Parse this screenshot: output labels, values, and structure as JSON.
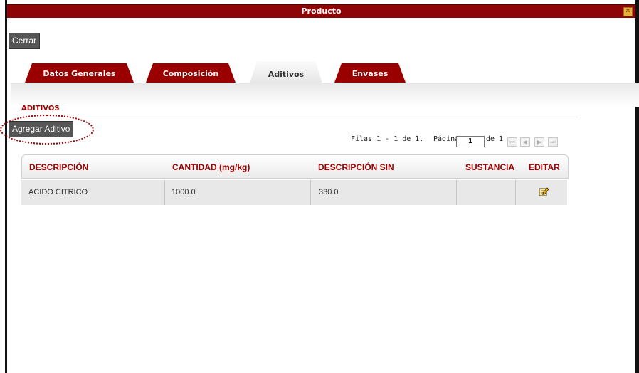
{
  "window": {
    "title": "Producto",
    "close_glyph": "✕"
  },
  "toolbar": {
    "close_label": "Cerrar"
  },
  "tabs": [
    {
      "label": "Datos Generales",
      "active": false
    },
    {
      "label": "Composición",
      "active": false
    },
    {
      "label": "Aditivos",
      "active": true
    },
    {
      "label": "Envases",
      "active": false
    }
  ],
  "section": {
    "title": "ADITIVOS",
    "add_label": "Agregar Aditivo"
  },
  "pager": {
    "rows_text": "Filas 1 - 1 de 1.",
    "page_label": "Página",
    "page_value": "1",
    "of_text": "de 1",
    "nav_icons": [
      "first-icon",
      "prev-icon",
      "next-icon",
      "last-icon"
    ]
  },
  "table": {
    "columns": [
      "DESCRIPCIÓN",
      "CANTIDAD (mg/kg)",
      "DESCRIPCIÓN SIN",
      "SUSTANCIA",
      "EDITAR"
    ],
    "rows": [
      {
        "descripcion": "ACIDO CITRICO",
        "cantidad": "1000.0",
        "descripcion_sin": "330.0",
        "sustancia": "",
        "editar_icon": "edit-icon"
      }
    ]
  },
  "colors": {
    "brand_red": "#9a0000",
    "title_bar": "#8d0506",
    "dark_button": "#555555"
  }
}
